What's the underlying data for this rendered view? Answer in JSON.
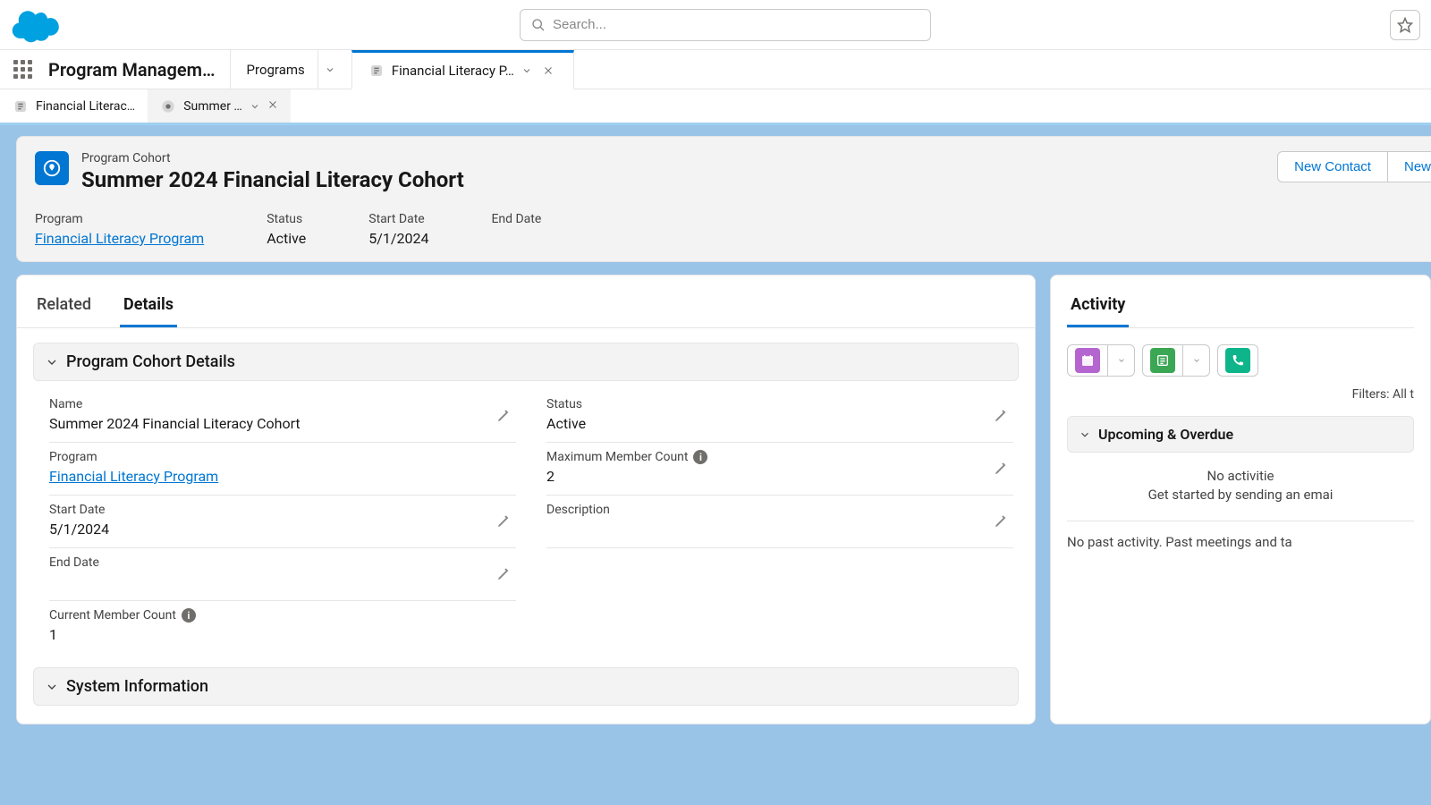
{
  "search": {
    "placeholder": "Search..."
  },
  "app": {
    "name": "Program Managem…"
  },
  "nav": {
    "programs_label": "Programs",
    "workspace_label": "Financial Literacy P…"
  },
  "subtabs": {
    "parent_label": "Financial Literac…",
    "child_label": "Summer …"
  },
  "highlights": {
    "object_label": "Program Cohort",
    "title": "Summer 2024 Financial Literacy Cohort",
    "actions": {
      "new_contact": "New Contact",
      "new_truncated": "New"
    },
    "fields": {
      "program_label": "Program",
      "program_value": "Financial Literacy Program",
      "status_label": "Status",
      "status_value": "Active",
      "start_label": "Start Date",
      "start_value": "5/1/2024",
      "end_label": "End Date",
      "end_value": ""
    }
  },
  "detail_tabs": {
    "related": "Related",
    "details": "Details"
  },
  "sections": {
    "cohort_title": "Program Cohort Details",
    "sysinfo_title": "System Information"
  },
  "details": {
    "name_label": "Name",
    "name_value": "Summer 2024 Financial Literacy Cohort",
    "status_label": "Status",
    "status_value": "Active",
    "program_label": "Program",
    "program_value": "Financial Literacy Program",
    "max_label": "Maximum Member Count",
    "max_value": "2",
    "start_label": "Start Date",
    "start_value": "5/1/2024",
    "desc_label": "Description",
    "desc_value": "",
    "end_label": "End Date",
    "end_value": "",
    "current_label": "Current Member Count",
    "current_value": "1"
  },
  "activity": {
    "tab_label": "Activity",
    "filters": "Filters: All t",
    "upcoming_label": "Upcoming & Overdue",
    "empty_line1": "No activitie",
    "empty_line2": "Get started by sending an emai",
    "past_text": "No past activity. Past meetings and ta"
  }
}
